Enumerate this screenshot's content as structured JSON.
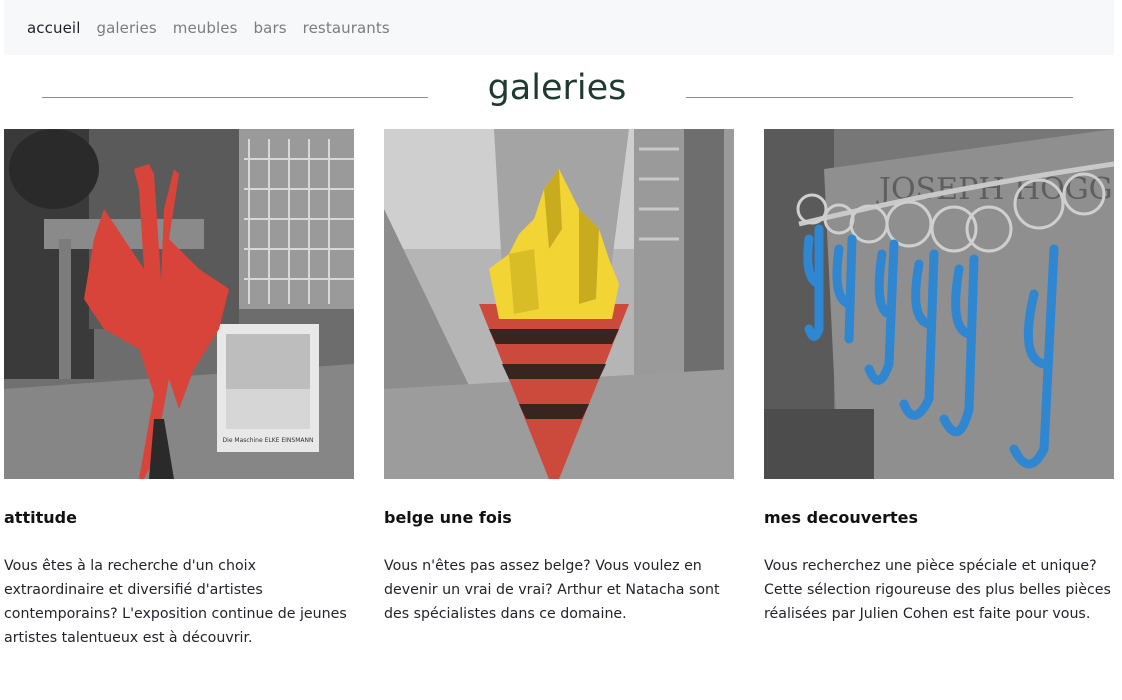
{
  "nav": {
    "items": [
      {
        "label": "accueil",
        "active": true
      },
      {
        "label": "galeries",
        "active": false
      },
      {
        "label": "meubles",
        "active": false
      },
      {
        "label": "bars",
        "active": false
      },
      {
        "label": "restaurants",
        "active": false
      }
    ]
  },
  "section": {
    "title": "galeries"
  },
  "cards": [
    {
      "title": "attitude",
      "text": "Vous êtes à la recherche d'un choix extraordinaire et diversifié d'artistes contemporains? L'exposition continue de jeunes artistes talentueux est à découvrir.",
      "book_caption": "Die Maschine ELKE EINSMANN"
    },
    {
      "title": "belge une fois",
      "text": "Vous n'êtes pas assez belge? Vous voulez en devenir un vrai de vrai? Arthur et Natacha sont des spécialistes dans ce domaine."
    },
    {
      "title": "mes decouvertes",
      "text": "Vous recherchez une pièce spéciale et unique? Cette sélection rigoureuse des plus belles pièces réalisées par Julien Cohen est faite pour vous.",
      "sign_text": "JOSEPH HOGG"
    }
  ],
  "colors": {
    "nav_bg": "#f7f8f9",
    "heading": "#1f3a30",
    "sculpture_red": "#d9443a",
    "fries_yellow": "#f2d534",
    "cone_red": "#cc4a3c",
    "keyring_blue": "#2f86d1"
  }
}
